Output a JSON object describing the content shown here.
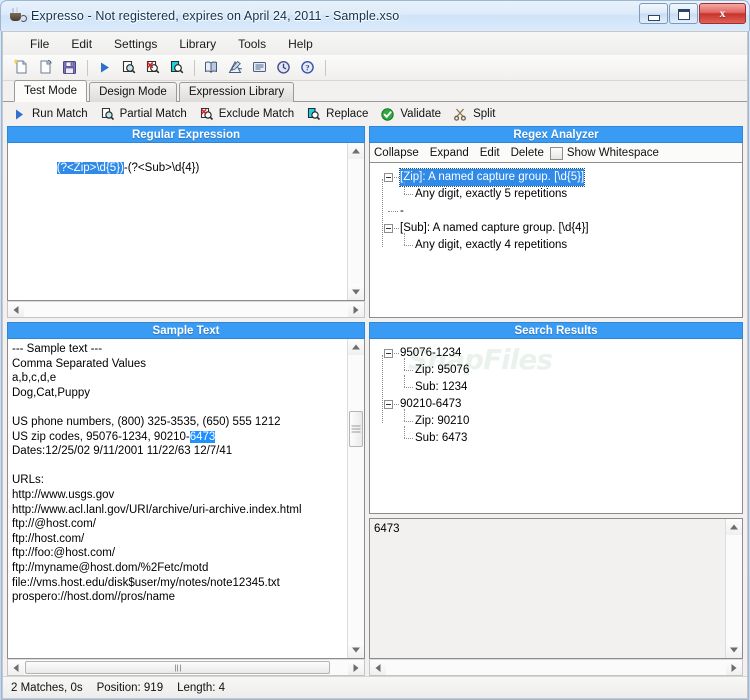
{
  "window": {
    "title": "Expresso - Not registered, expires on April 24, 2011 - Sample.xso",
    "icon": "coffee-cup-icon",
    "minimize": "–",
    "maximize": "□",
    "close": "x"
  },
  "menu": [
    "File",
    "Edit",
    "Settings",
    "Library",
    "Tools",
    "Help"
  ],
  "toolbar": [
    "new-document-icon",
    "open-document-icon",
    "save-icon",
    "separator",
    "run-match-icon",
    "partial-match-icon",
    "exclude-match-icon",
    "replace-icon",
    "separator",
    "library-book-icon",
    "design-ruler-icon",
    "report-icon",
    "history-clock-icon",
    "help-icon"
  ],
  "tabs": [
    {
      "label": "Test Mode",
      "active": true
    },
    {
      "label": "Design Mode",
      "active": false
    },
    {
      "label": "Expression Library",
      "active": false
    }
  ],
  "actions": [
    {
      "label": "Run Match",
      "icon": "play-triangle-icon"
    },
    {
      "label": "Partial Match",
      "icon": "partial-match-icon"
    },
    {
      "label": "Exclude Match",
      "icon": "exclude-match-icon"
    },
    {
      "label": "Replace",
      "icon": "replace-icon"
    },
    {
      "label": "Validate",
      "icon": "validate-check-icon"
    },
    {
      "label": "Split",
      "icon": "split-scissors-icon"
    }
  ],
  "regex_panel": {
    "title": "Regular Expression",
    "selected_text": "(?<Zip>\\d{5})",
    "rest_text": "-(?<Sub>\\d{4})"
  },
  "analyzer_panel": {
    "title": "Regex Analyzer",
    "tools": [
      "Collapse",
      "Expand",
      "Edit",
      "Delete"
    ],
    "checkbox_label": "Show Whitespace",
    "checkbox_checked": false,
    "tree": [
      {
        "label": "[Zip]: A named capture group. [\\d{5}]",
        "level": 0,
        "expander": true,
        "selected": true
      },
      {
        "label": "Any digit, exactly 5 repetitions",
        "level": 1,
        "expander": false,
        "selected": false
      },
      {
        "label": "-",
        "level": 0,
        "expander": false,
        "selected": false
      },
      {
        "label": "[Sub]: A named capture group. [\\d{4}]",
        "level": 0,
        "expander": true,
        "selected": false
      },
      {
        "label": "Any digit, exactly 4 repetitions",
        "level": 1,
        "expander": false,
        "selected": false
      }
    ]
  },
  "sample_panel": {
    "title": "Sample Text",
    "lines_before": "--- Sample text ---\nComma Separated Values\na,b,c,d,e\nDog,Cat,Puppy\n\nUS phone numbers, (800) 325-3535, (650) 555 1212\nUS zip codes, 95076-1234, 90210-",
    "highlight": "6473",
    "lines_after": "\nDates:12/25/02 9/11/2001 11/22/63 12/7/41\n\nURLs:\nhttp://www.usgs.gov\nhttp://www.acl.lanl.gov/URI/archive/uri-archive.index.html\nftp://@host.com/\nftp://host.com/\nftp://foo:@host.com/\nftp://myname@host.dom/%2Fetc/motd\nfile://vms.host.edu/disk$user/my/notes/note12345.txt\nprospero://host.dom//pros/name"
  },
  "results_panel": {
    "title": "Search Results",
    "watermark": "SnapFiles",
    "tree": [
      {
        "label": "95076-1234",
        "level": 0,
        "expander": true
      },
      {
        "label": "Zip: 95076",
        "level": 1,
        "expander": false
      },
      {
        "label": "Sub: 1234",
        "level": 1,
        "expander": false
      },
      {
        "label": "90210-6473",
        "level": 0,
        "expander": true
      },
      {
        "label": "Zip: 90210",
        "level": 1,
        "expander": false
      },
      {
        "label": "Sub: 6473",
        "level": 1,
        "expander": false
      }
    ],
    "detail_value": "6473"
  },
  "statusbar": {
    "matches": "2 Matches, 0s",
    "position": "Position: 919",
    "length": "Length: 4"
  },
  "colors": {
    "panel_header": "#3a9bf4",
    "selection": "#2f8ae8",
    "accent": "#1e90ff"
  }
}
